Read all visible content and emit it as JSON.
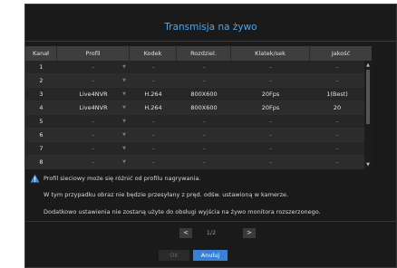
{
  "dialog": {
    "title": "Transmisja na żywo"
  },
  "table": {
    "headers": [
      "Kanał",
      "Profil",
      "Kodek",
      "Rozdziel.",
      "Klatek/sek",
      "Jakość"
    ],
    "rows": [
      {
        "channel": "1",
        "profile": "–",
        "codec": "–",
        "resolution": "–",
        "fps": "–",
        "quality": "–"
      },
      {
        "channel": "2",
        "profile": "–",
        "codec": "–",
        "resolution": "–",
        "fps": "–",
        "quality": "–"
      },
      {
        "channel": "3",
        "profile": "Live4NVR",
        "codec": "H.264",
        "resolution": "800X600",
        "fps": "20Fps",
        "quality": "1(Best)"
      },
      {
        "channel": "4",
        "profile": "Live4NVR",
        "codec": "H.264",
        "resolution": "800X600",
        "fps": "20Fps",
        "quality": "20"
      },
      {
        "channel": "5",
        "profile": "–",
        "codec": "–",
        "resolution": "–",
        "fps": "–",
        "quality": "–"
      },
      {
        "channel": "6",
        "profile": "–",
        "codec": "–",
        "resolution": "–",
        "fps": "–",
        "quality": "–"
      },
      {
        "channel": "7",
        "profile": "–",
        "codec": "–",
        "resolution": "–",
        "fps": "–",
        "quality": "–"
      },
      {
        "channel": "8",
        "profile": "–",
        "codec": "–",
        "resolution": "–",
        "fps": "–",
        "quality": "–"
      }
    ]
  },
  "notes": {
    "line1": "Profil sieciowy może się różnić od profilu nagrywania.",
    "line2": "W tym przypadku obraz nie będzie przesyłany z pręd. odśw. ustawioną w kamerze.",
    "line3": "Dodatkowo ustawienia nie zostaną użyte do obsługi wyjścia na żywo monitora rozszerzonego."
  },
  "pager": {
    "prev": "<",
    "next": ">",
    "indicator": "1/2"
  },
  "buttons": {
    "ok": "OK",
    "cancel": "Anuluj"
  },
  "colors": {
    "title": "#4ea6f0",
    "cancel_bg": "#3b7fd0",
    "warning": "#3f8fe0"
  }
}
